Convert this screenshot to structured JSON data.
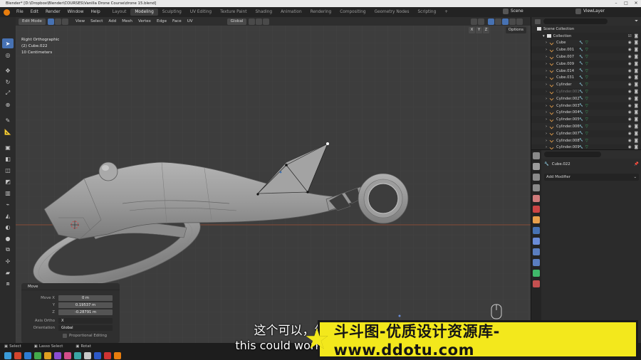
{
  "window": {
    "title": "Blender* [D:\\Dropbox\\Blender\\COURSES\\Vanilla Drone Course\\drone 15.blend]"
  },
  "menu": [
    "File",
    "Edit",
    "Render",
    "Window",
    "Help"
  ],
  "workspaces": [
    "Layout",
    "Modeling",
    "Sculpting",
    "UV Editing",
    "Texture Paint",
    "Shading",
    "Animation",
    "Rendering",
    "Compositing",
    "Geometry Nodes",
    "Scripting"
  ],
  "active_workspace": "Modeling",
  "scene_label": "Scene",
  "viewlayer_label": "ViewLayer",
  "viewport": {
    "mode": "Edit Mode",
    "header_menus": [
      "View",
      "Select",
      "Add",
      "Mesh",
      "Vertex",
      "Edge",
      "Face",
      "UV"
    ],
    "transform_orientation": "Global",
    "options_label": "Options",
    "axes": [
      "X",
      "Y",
      "Z"
    ],
    "info": {
      "view": "Right Orthographic",
      "object": "(2) Cube.022",
      "scale": "10 Centimeters"
    }
  },
  "operator_panel": {
    "title": "Move",
    "fields": [
      {
        "label": "Move X",
        "value": "0 m"
      },
      {
        "label": "Y",
        "value": "0.19537 m"
      },
      {
        "label": "Z",
        "value": "-0.28791 m"
      }
    ],
    "axis_ortho": {
      "label": "Axis Ortho",
      "value": "X"
    },
    "orientation": {
      "label": "Orientation",
      "value": "Global"
    },
    "proportional": "Proportional Editing"
  },
  "outliner": {
    "root": "Scene Collection",
    "collection": "Collection",
    "items": [
      "Cube",
      "Cube.001",
      "Cube.007",
      "Cube.009",
      "Cube.014",
      "Cube.031",
      "Cylinder",
      "Cylinder.001",
      "Cylinder.002",
      "Cylinder.003",
      "Cylinder.004",
      "Cylinder.005",
      "Cylinder.006",
      "Cylinder.007",
      "Cylinder.008",
      "Cylinder.009"
    ],
    "dimmed": [
      "Cylinder.001"
    ]
  },
  "properties": {
    "object_name": "Cube.022",
    "add_modifier": "Add Modifier"
  },
  "statusbar": {
    "select": "Select",
    "lasso": "Lasso Select",
    "rotate": "Rotat"
  },
  "subtitles": {
    "chinese": "这个可以，然后我们可以",
    "english": "this could work then we could"
  },
  "watermark": {
    "text": "斗斗图-优质设计资源库-www.ddotu.com"
  },
  "colors": {
    "accent": "#4772b3",
    "blender_orange": "#e87d0d",
    "watermark_yellow": "#f3e81c",
    "mesh_gray": "#9a9a9a"
  }
}
